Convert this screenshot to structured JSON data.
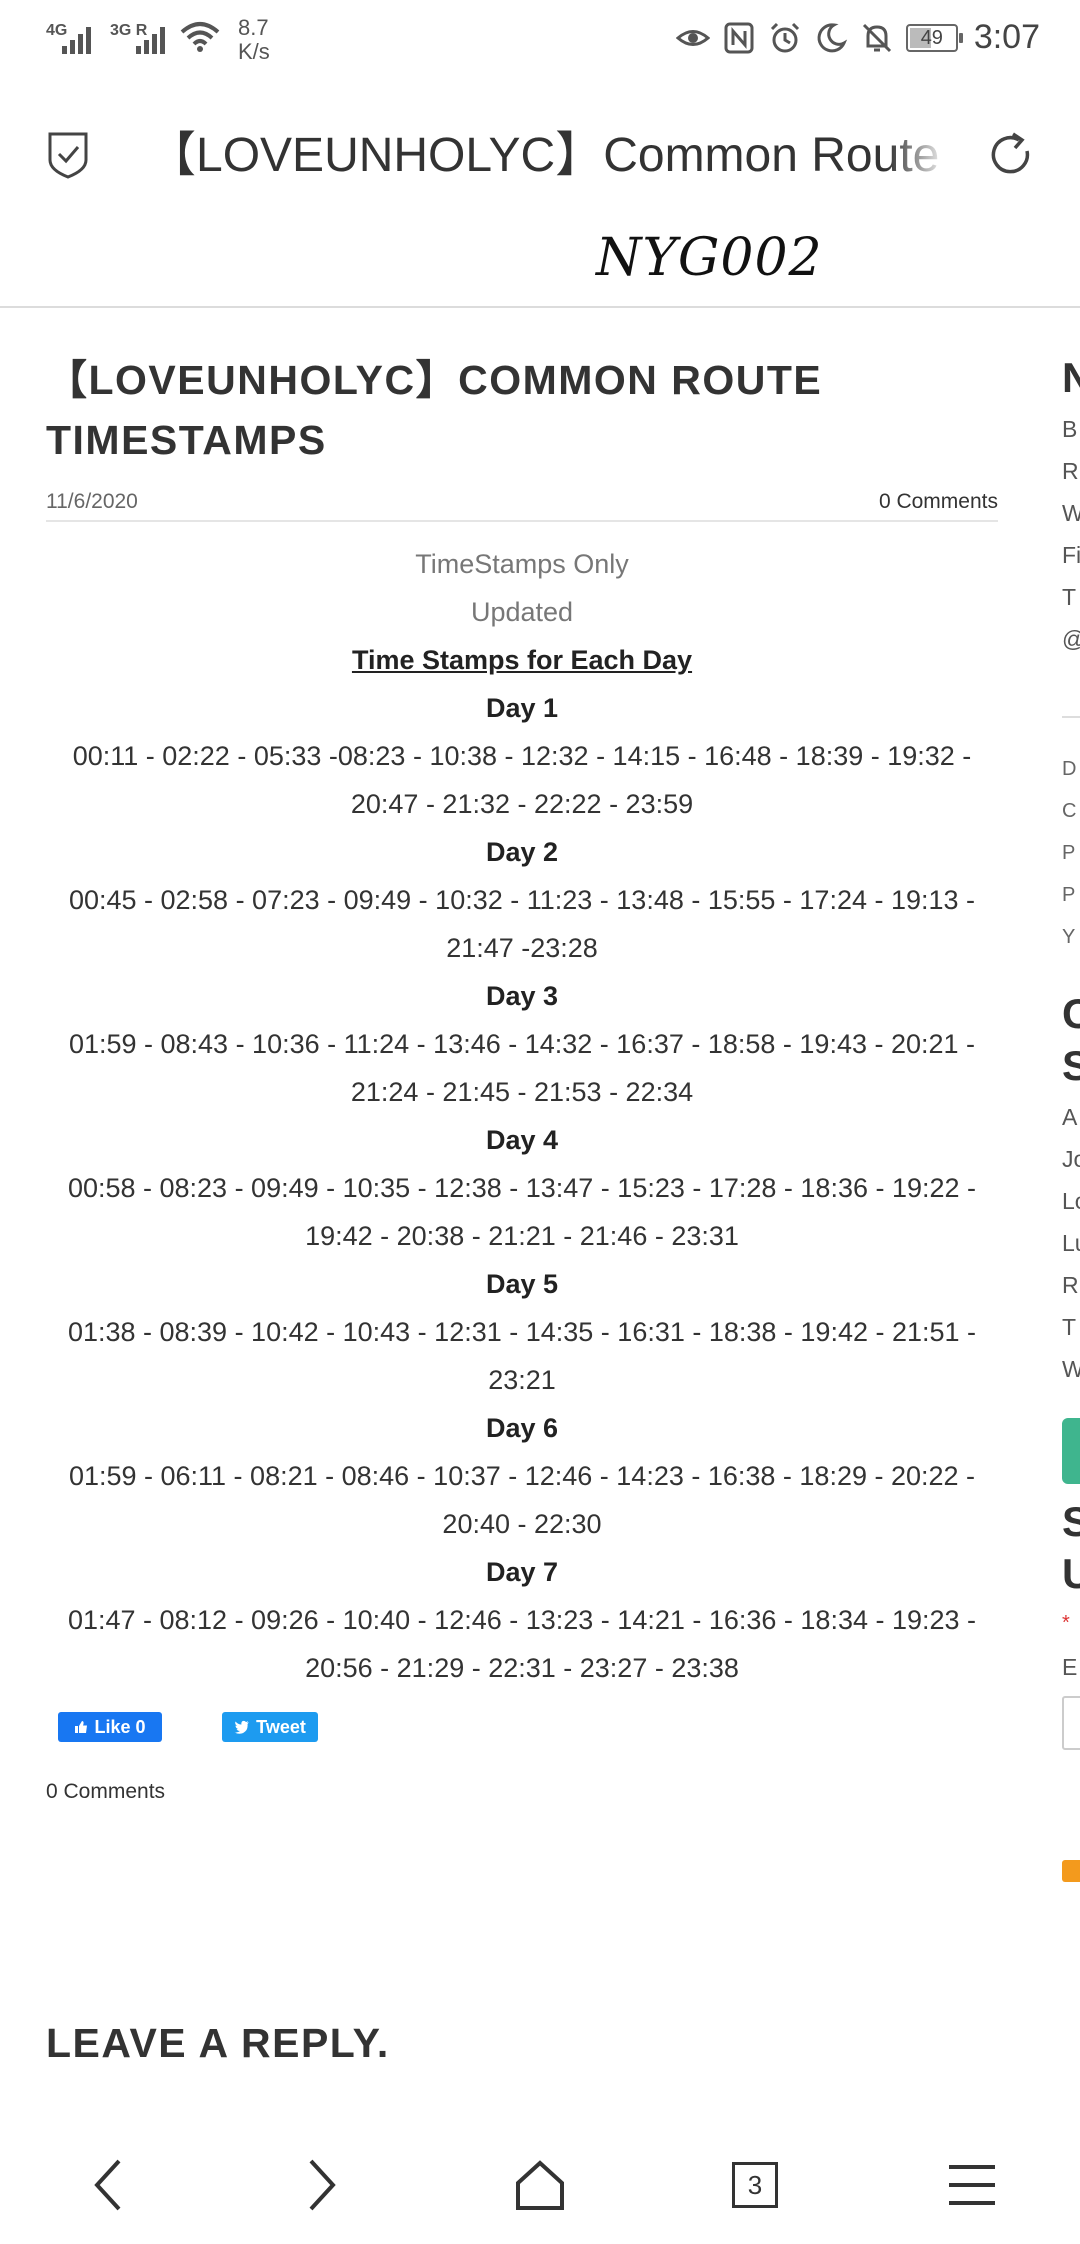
{
  "status_bar": {
    "network1": "4G",
    "network2": "3G R",
    "speed_value": "8.7",
    "speed_unit": "K/s",
    "battery": "49",
    "battery_level_percent": 49,
    "time": "3:07",
    "icons": [
      "eye-icon",
      "nfc-icon",
      "alarm-icon",
      "moon-icon",
      "bell-off-icon",
      "battery-icon"
    ]
  },
  "browser": {
    "tab_title": "【LOVEUNHOLYC】Common Route Timestamps",
    "shield_icon": "shield-check-icon",
    "reload_icon": "reload-icon"
  },
  "site": {
    "logo": "NYG002"
  },
  "post": {
    "title": "【LOVEUNHOLYC】COMMON ROUTE TIMESTAMPS",
    "date": "11/6/2020",
    "comments_link": "0 Comments",
    "intro1": "TimeStamps Only",
    "intro2": "Updated",
    "section_heading": "Time Stamps for Each Day ",
    "days": [
      {
        "label": "Day 1",
        "times": "00:11 - 02:22 - 05:33 -08:23 - 10:38 - 12:32 - 14:15 - 16:48 - 18:39 - 19:32 - 20:47 - 21:32 - 22:22 - 23:59"
      },
      {
        "label": "Day 2",
        "times": "00:45 - 02:58 - 07:23 - 09:49 - 10:32 - 11:23 - 13:48 - 15:55 - 17:24 - 19:13 - 21:47 -23:28"
      },
      {
        "label": "Day 3",
        "times": "01:59 - 08:43 - 10:36 - 11:24 - 13:46 - 14:32 - 16:37 - 18:58 - 19:43 - 20:21 - 21:24 - 21:45 - 21:53 - 22:34"
      },
      {
        "label": "Day 4",
        "times": "00:58  - 08:23 - 09:49 - 10:35 - 12:38 - 13:47 - 15:23 - 17:28 - 18:36 - 19:22 - 19:42 - 20:38 - 21:21 - 21:46 - 23:31"
      },
      {
        "label": "Day 5",
        "times": "01:38 - 08:39 - 10:42 - 10:43 - 12:31 - 14:35 - 16:31 - 18:38 - 19:42 - 21:51 - 23:21"
      },
      {
        "label": "Day 6",
        "times": "01:59 - 06:11 - 08:21 - 08:46 - 10:37 - 12:46 - 14:23 - 16:38 - 18:29 - 20:22 - 20:40 - 22:30"
      },
      {
        "label": "Day 7",
        "times": "01:47 - 08:12 - 09:26 - 10:40 - 12:46 - 13:23 - 14:21 - 16:36 - 18:34 - 19:23 - 20:56 - 21:29 - 22:31 - 23:27 - 23:38"
      }
    ],
    "fb_like": "Like 0",
    "tweet": "Tweet",
    "comments_count": "0 Comments",
    "leave_reply": "LEAVE A REPLY."
  },
  "sidebar": {
    "heading1": "N",
    "links1": [
      "B",
      "R",
      "W",
      "Fi",
      "T",
      "@"
    ],
    "links2": [
      "D",
      "C",
      "P",
      "P",
      "Y"
    ],
    "heading2a": "C",
    "heading2b": "S",
    "links3": [
      "A",
      "Jo",
      "Lo",
      "Lu",
      "R",
      "T",
      "W"
    ],
    "heading3a": "S",
    "heading3b": "U",
    "required_mark": "* ",
    "email_label": "E"
  },
  "bottom_nav": {
    "back_icon": "chevron-left-icon",
    "forward_icon": "chevron-right-icon",
    "home_icon": "home-icon",
    "tabs_count": "3",
    "menu_icon": "menu-icon"
  }
}
